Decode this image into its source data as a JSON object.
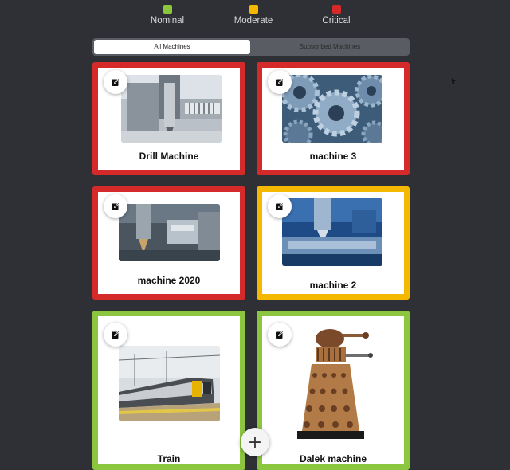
{
  "legend": [
    {
      "label": "Nominal",
      "color": "#8cc63f"
    },
    {
      "label": "Moderate",
      "color": "#f5b800"
    },
    {
      "label": "Critical",
      "color": "#d42a2a"
    }
  ],
  "tabs": {
    "all": "All Machines",
    "subscribed": "Subscribed Machines",
    "active": "all"
  },
  "machines": [
    {
      "name": "Drill Machine",
      "status": "critical",
      "status_color": "#d42a2a",
      "image": "drill-machine-photo"
    },
    {
      "name": "machine 3",
      "status": "critical",
      "status_color": "#d42a2a",
      "image": "gears-photo"
    },
    {
      "name": "machine 2020",
      "status": "critical",
      "status_color": "#d42a2a",
      "image": "milling-cutter-photo"
    },
    {
      "name": "machine 2",
      "status": "moderate",
      "status_color": "#f5b800",
      "image": "cnc-machine-photo"
    },
    {
      "name": "Train",
      "status": "nominal",
      "status_color": "#8cc63f",
      "image": "train-photo"
    },
    {
      "name": "Dalek machine",
      "status": "nominal",
      "status_color": "#8cc63f",
      "image": "dalek-photo"
    }
  ],
  "icons": {
    "edit": "edit-icon",
    "add": "plus-icon"
  },
  "add_button": "+"
}
